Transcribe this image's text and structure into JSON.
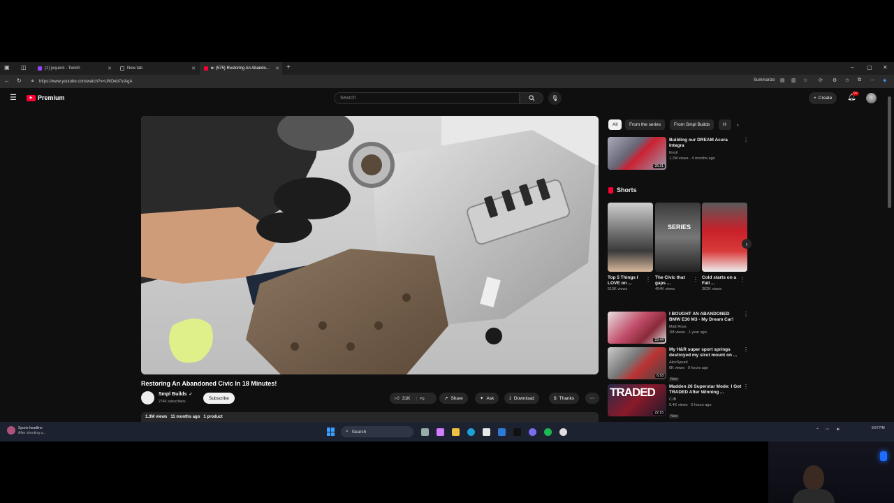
{
  "browser": {
    "tabs": [
      {
        "label": "(1) jxquent - Twitch"
      },
      {
        "label": "New tab"
      },
      {
        "label": "(575) Restoring An Abando..."
      }
    ],
    "url": "https://www.youtube.com/watch?v=LWOeb7uIAgA",
    "summarize_label": "Summarize"
  },
  "youtube": {
    "brand": "Premium",
    "search_placeholder": "Search",
    "create_label": "Create",
    "notif_count": "9+",
    "video": {
      "title": "Restoring An Abandoned Civic In 18 Minutes!",
      "channel": "Smpl Builds",
      "subscribers": "274K subscribers",
      "subscribe_label": "Subscribe",
      "likes": "31K",
      "share_label": "Share",
      "ask_label": "Ask",
      "download_label": "Download",
      "thanks_label": "Thanks",
      "views": "1.3M views",
      "age": "11 months ago",
      "product": "1 product"
    },
    "chips": [
      "All",
      "From the series",
      "From Smpl Builds",
      "H"
    ],
    "top_rec": {
      "title": "Building our DREAM Acura Integra",
      "channel": "throtl",
      "meta": "1.2M views · 4 months ago",
      "duration": "26:31"
    },
    "shorts_label": "Shorts",
    "shorts": [
      {
        "title": "Top 5 Things I LOVE on ...",
        "views": "515K views"
      },
      {
        "title": "The Civic that gaps ...",
        "views": "494K views",
        "overlay": "SERIES"
      },
      {
        "title": "Cold starts on a Fall ...",
        "views": "362K views"
      }
    ],
    "recs": [
      {
        "title": "I BOUGHT AN ABANDONED BMW E30 M3 - My Dream Car!",
        "channel": "Matt Ross",
        "meta": "1M views · 1 year ago",
        "duration": "22:44",
        "badge": ""
      },
      {
        "title": "My H&R super sport springs destroyed my strut mount on ...",
        "channel": "AlexSpeed",
        "meta": "6K views · 9 hours ago",
        "duration": "6:18",
        "badge": "New"
      },
      {
        "title": "Madden 26 Superstar Mode: I Got TRADED After Winning ...",
        "channel": "CJB",
        "meta": "9.4K views · 5 hours ago",
        "duration": "22:15",
        "badge": "New",
        "thumb_text": "TRADED"
      }
    ]
  },
  "taskbar": {
    "news_title": "Sports headline",
    "news_sub": "After shooting a...",
    "search_label": "Search",
    "time": "9:57 PM"
  },
  "colors": {
    "yt_red": "#ff0033",
    "page_bg": "#0f0f0f",
    "chip_bg": "#272727"
  }
}
